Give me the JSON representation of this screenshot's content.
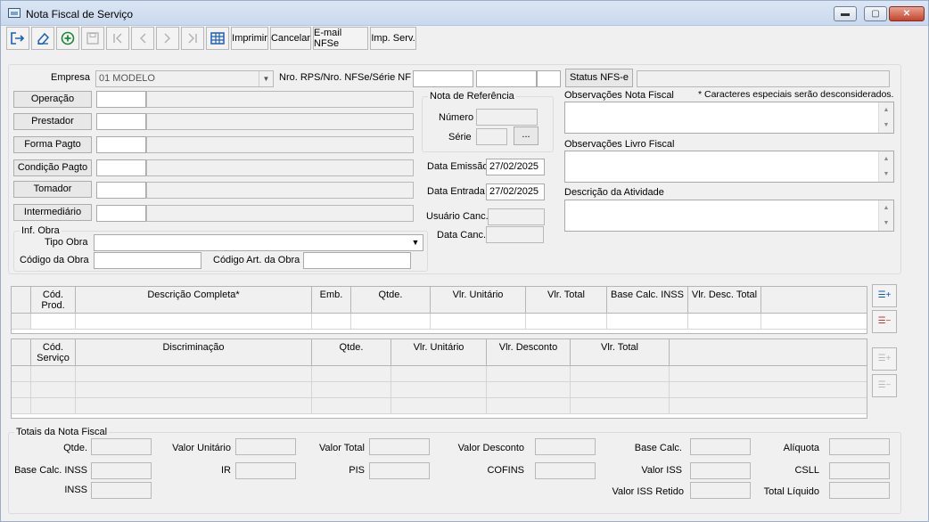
{
  "window": {
    "title": "Nota Fiscal de Serviço",
    "minimize": "▬",
    "maximize": "▢",
    "close": "✕"
  },
  "toolbar": {
    "imprimir": "Imprimir",
    "cancelar": "Cancelar",
    "email": "E-mail NFSe",
    "imp_serv": "Imp. Serv."
  },
  "form": {
    "empresa_label": "Empresa",
    "empresa_value": "01 MODELO",
    "nro_rps_label": "Nro. RPS/Nro. NFSe/Série NF",
    "status_button": "Status NFS-e",
    "operacao": "Operação",
    "prestador": "Prestador",
    "forma_pagto": "Forma Pagto",
    "condicao_pagto": "Condição Pagto",
    "tomador": "Tomador",
    "intermediario": "Intermediário",
    "nota_ref_title": "Nota de Referência",
    "numero_label": "Número",
    "serie_label": "Série",
    "ellipsis": "...",
    "data_emissao_label": "Data Emissão",
    "data_emissao_value": "27/02/2025",
    "data_entrada_label": "Data Entrada",
    "data_entrada_value": "27/02/2025",
    "usuario_canc_label": "Usuário Canc.",
    "data_canc_label": "Data Canc.",
    "obs_nota_label": "Observações Nota Fiscal",
    "caracteres_note": "* Caracteres especiais serão desconsiderados.",
    "obs_livro_label": "Observações Livro Fiscal",
    "descricao_atividade_label": "Descrição da Atividade",
    "inf_obra_title": "Inf. Obra",
    "tipo_obra_label": "Tipo Obra",
    "codigo_obra_label": "Código da Obra",
    "codigo_art_label": "Código Art. da Obra"
  },
  "products_grid": {
    "headers": [
      "Cód.\nProd.",
      "Descrição Completa*",
      "Emb.",
      "Qtde.",
      "Vlr. Unitário",
      "Vlr. Total",
      "Base Calc. INSS",
      "Vlr. Desc. Total"
    ]
  },
  "services_grid": {
    "headers": [
      "Cód.\nServiço",
      "Discriminação",
      "Qtde.",
      "Vlr. Unitário",
      "Vlr. Desconto",
      "Vlr. Total"
    ]
  },
  "totals": {
    "title": "Totais da Nota Fiscal",
    "qtde": "Qtde.",
    "valor_unitario": "Valor Unitário",
    "valor_total": "Valor Total",
    "valor_desconto": "Valor Desconto",
    "base_calc": "Base Calc.",
    "aliquota": "Alíquota",
    "base_calc_inss": "Base Calc. INSS",
    "ir": "IR",
    "pis": "PIS",
    "cofins": "COFINS",
    "valor_iss": "Valor ISS",
    "csll": "CSLL",
    "inss": "INSS",
    "valor_iss_retido": "Valor ISS Retido",
    "total_liquido": "Total Líquido"
  },
  "side_buttons": {
    "add": "☰+",
    "remove": "☰−"
  },
  "colors": {
    "accent": "#0a57b5",
    "close_red": "#c4442c"
  }
}
